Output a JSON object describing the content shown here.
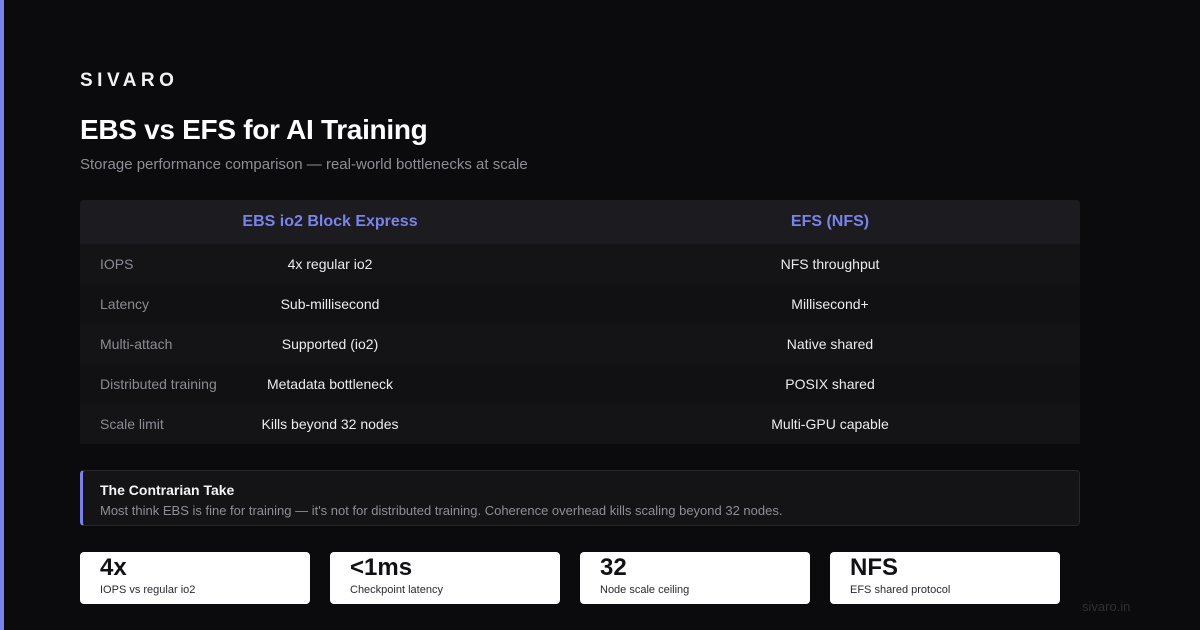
{
  "brand": "SIVARO",
  "title": "EBS vs EFS for AI Training",
  "subtitle": "Storage performance comparison — real-world bottlenecks at scale",
  "table": {
    "headers": [
      "EBS io2 Block Express",
      "EFS (NFS)"
    ],
    "rows": [
      {
        "label": "IOPS",
        "left": "4x regular io2",
        "right": "NFS throughput"
      },
      {
        "label": "Latency",
        "left": "Sub-millisecond",
        "right": "Millisecond+"
      },
      {
        "label": "Multi-attach",
        "left": "Supported (io2)",
        "right": "Native shared"
      },
      {
        "label": "Distributed training",
        "left": "Metadata bottleneck",
        "right": "POSIX shared"
      },
      {
        "label": "Scale limit",
        "left": "Kills beyond 32 nodes",
        "right": "Multi-GPU capable"
      }
    ]
  },
  "callout": {
    "title": "The Contrarian Take",
    "text": "Most think EBS is fine for training — it's not for distributed training. Coherence overhead kills scaling beyond 32 nodes."
  },
  "stats": [
    {
      "value": "4x",
      "label": "IOPS vs regular io2"
    },
    {
      "value": "<1ms",
      "label": "Checkpoint latency"
    },
    {
      "value": "32",
      "label": "Node scale ceiling"
    },
    {
      "value": "NFS",
      "label": "EFS shared protocol"
    }
  ],
  "footer_url": "sivaro.in",
  "colors": {
    "accent": "#7b83eb",
    "background": "#0b0b0d",
    "card": "#ffffff"
  }
}
